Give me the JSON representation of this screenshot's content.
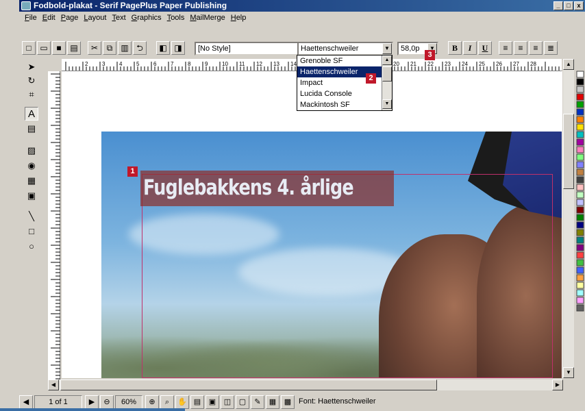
{
  "window": {
    "title": "Fodbold-plakat - Serif PagePlus Paper Publishing",
    "min": "_",
    "max": "□",
    "close": "x"
  },
  "menu": [
    "File",
    "Edit",
    "Page",
    "Layout",
    "Text",
    "Graphics",
    "Tools",
    "MailMerge",
    "Help"
  ],
  "toolbar": {
    "style_value": "[No Style]",
    "font_value": "Haettenschweiler",
    "size_value": "58,0p",
    "bold": "B",
    "italic": "I",
    "underline": "U"
  },
  "font_dropdown": {
    "items": [
      "Grenoble SF",
      "Haettenschweiler",
      "Impact",
      "Lucida Console",
      "Mackintosh SF"
    ],
    "selected": "Haettenschweiler"
  },
  "document": {
    "headline": "Fuglebakkens 4. årlige"
  },
  "callouts": [
    "1",
    "2",
    "3"
  ],
  "ruler_marks": [
    "2",
    "3",
    "4",
    "5",
    "6",
    "7",
    "8",
    "9",
    "10",
    "11",
    "12",
    "13",
    "14",
    "15",
    "16",
    "17",
    "18",
    "19",
    "20",
    "21",
    "22",
    "23",
    "24",
    "25",
    "26",
    "27",
    "28"
  ],
  "status": {
    "page": "1 of 1",
    "zoom": "60%",
    "font_info": "Font: Haettenschweiler"
  },
  "palette_colors": [
    "#ffffff",
    "#000000",
    "#c8c8c8",
    "#e00000",
    "#00a000",
    "#0030c0",
    "#ff8000",
    "#ffe000",
    "#00c0c0",
    "#a000a0",
    "#ff80c0",
    "#80ff80",
    "#8080ff",
    "#c08040",
    "#404040",
    "#ffc0c0",
    "#c0ffc0",
    "#c0c0ff",
    "#800000",
    "#008000",
    "#000080",
    "#808000",
    "#008080",
    "#800080",
    "#ff4040",
    "#40c040",
    "#4060ff",
    "#ffa040",
    "#ffffa0",
    "#a0ffff",
    "#ffa0ff",
    "#606060"
  ]
}
